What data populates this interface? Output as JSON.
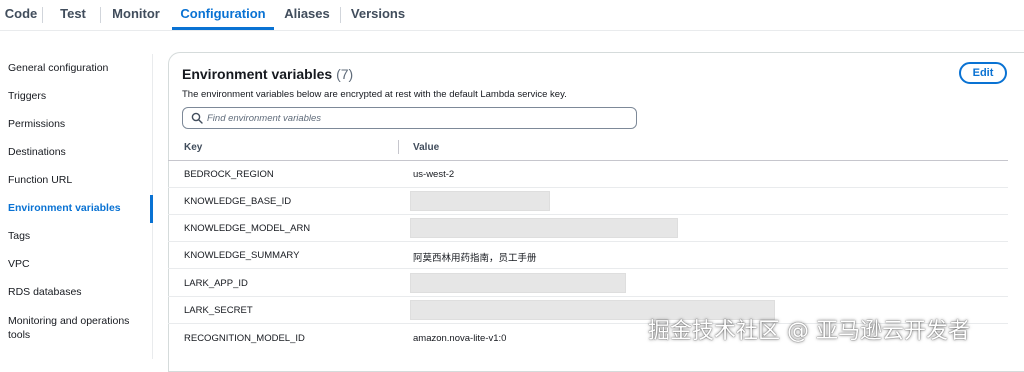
{
  "tabs": [
    {
      "label": "Code"
    },
    {
      "label": "Test"
    },
    {
      "label": "Monitor"
    },
    {
      "label": "Configuration"
    },
    {
      "label": "Aliases"
    },
    {
      "label": "Versions"
    }
  ],
  "sidebar": {
    "items": [
      {
        "label": "General configuration"
      },
      {
        "label": "Triggers"
      },
      {
        "label": "Permissions"
      },
      {
        "label": "Destinations"
      },
      {
        "label": "Function URL"
      },
      {
        "label": "Environment variables"
      },
      {
        "label": "Tags"
      },
      {
        "label": "VPC"
      },
      {
        "label": "RDS databases"
      },
      {
        "label": "Monitoring and operations"
      },
      {
        "label": "tools"
      }
    ],
    "active": "Environment variables"
  },
  "panel": {
    "title": "Environment variables",
    "count": "(7)",
    "description": "The environment variables below are encrypted at rest with the default Lambda service key.",
    "edit_label": "Edit",
    "search_placeholder": "Find environment variables"
  },
  "table": {
    "headers": {
      "key": "Key",
      "value": "Value"
    },
    "rows": [
      {
        "key": "BEDROCK_REGION",
        "value": "us-west-2"
      },
      {
        "key": "KNOWLEDGE_BASE_ID",
        "value": ""
      },
      {
        "key": "KNOWLEDGE_MODEL_ARN",
        "value": ""
      },
      {
        "key": "KNOWLEDGE_SUMMARY",
        "value": "阿莫西林用药指南，员工手册"
      },
      {
        "key": "LARK_APP_ID",
        "value": ""
      },
      {
        "key": "LARK_SECRET",
        "value": ""
      },
      {
        "key": "RECOGNITION_MODEL_ID",
        "value": "amazon.nova-lite-v1:0"
      }
    ]
  },
  "watermark": "掘金技术社区 @ 亚马逊云开发者",
  "colors": {
    "accent": "#0972d3",
    "text": "#16191f",
    "border": "#d5dbdb"
  }
}
